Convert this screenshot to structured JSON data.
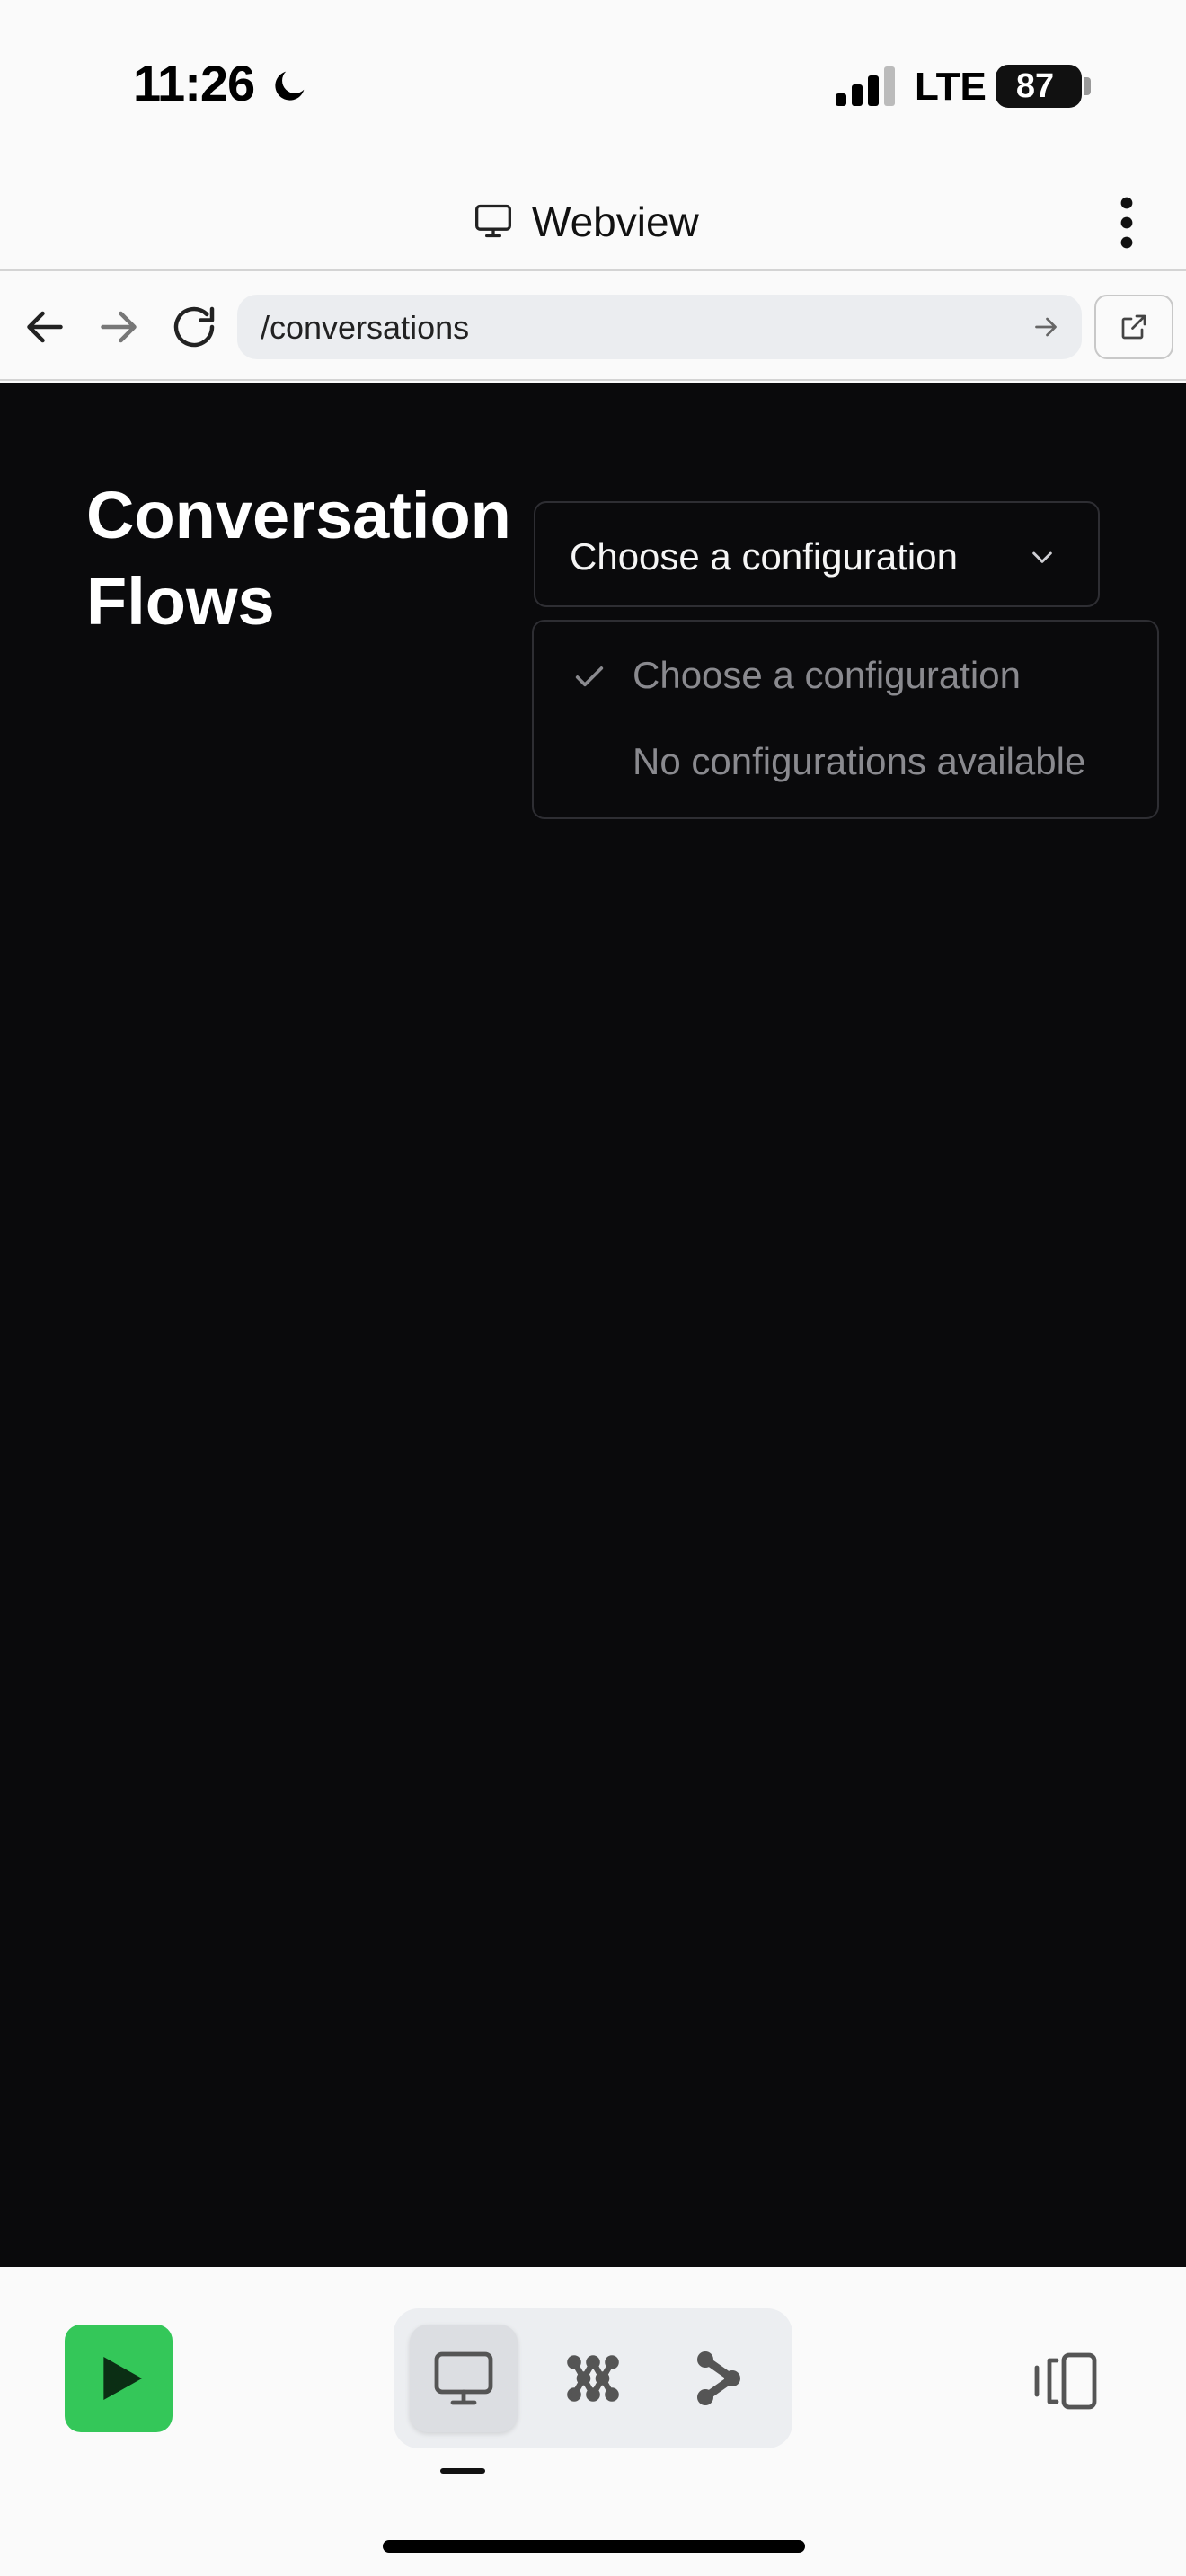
{
  "status_bar": {
    "time": "11:26",
    "network": "LTE",
    "battery": "87",
    "icons": [
      "moon-icon",
      "signal-icon",
      "battery-icon"
    ]
  },
  "title_bar": {
    "title": "Webview",
    "icons": [
      "monitor-icon",
      "more-options-icon"
    ]
  },
  "url_bar": {
    "url": "/conversations",
    "icons": [
      "back-arrow-icon",
      "forward-arrow-icon",
      "reload-icon",
      "go-arrow-icon",
      "external-link-icon"
    ]
  },
  "page": {
    "title": "Conversation Flows",
    "select": {
      "selected": "Choose a configuration",
      "options": [
        {
          "label": "Choose a configuration",
          "checked": true
        },
        {
          "label": "No configurations available",
          "checked": false
        }
      ]
    }
  },
  "toolbar": {
    "icons": [
      "play-icon",
      "monitor-icon",
      "nodes-icon",
      "flow-icon",
      "sidebar-panel-icon"
    ],
    "active_tab": "monitor"
  },
  "colors": {
    "content_bg": "#0a0a0c",
    "play_green": "#34c759",
    "option_gray": "#8a8a8f"
  }
}
